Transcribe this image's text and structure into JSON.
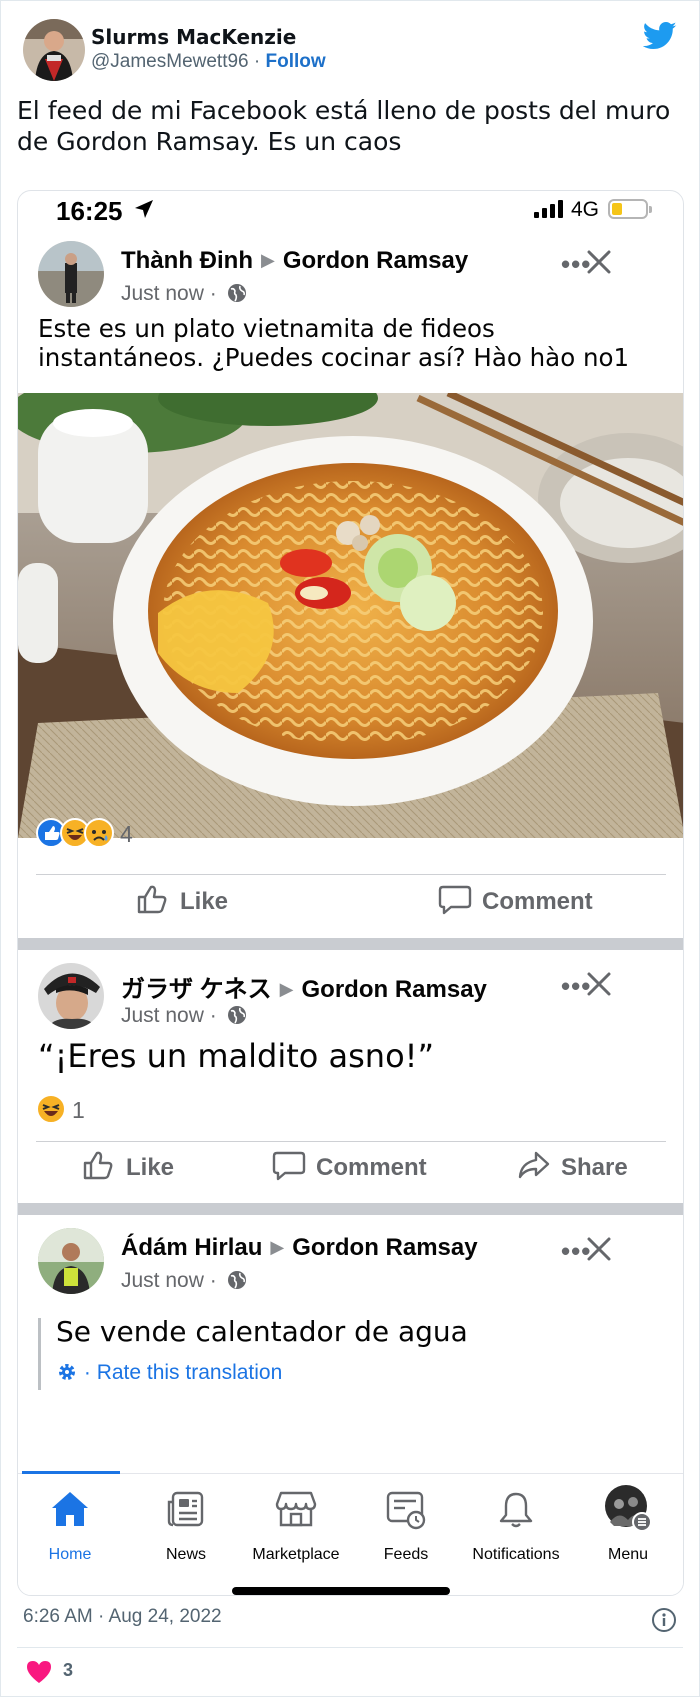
{
  "tweet": {
    "author_name": "Slurms MacKenzie",
    "handle": "@JamesMewett96",
    "separator": "·",
    "follow_label": "Follow",
    "text": "El feed de mi Facebook está lleno de posts del muro de Gordon Ramsay. Es un caos",
    "timestamp": "6:26 AM · Aug 24, 2022",
    "like_count": "3",
    "brand_color": "#1d9bf0",
    "like_color": "#f91880"
  },
  "phone": {
    "time": "16:25",
    "network": "4G"
  },
  "posts": [
    {
      "author": "Thành Đinh",
      "target": "Gordon Ramsay",
      "time": "Just now",
      "dot": "·",
      "text": "Este es un plato vietnamita de fideos instantáneos. ¿Puedes cocinar así? Hào hào no1",
      "reactions": [
        "like",
        "haha",
        "sad"
      ],
      "reaction_count": "4",
      "actions": [
        "Like",
        "Comment"
      ]
    },
    {
      "author": "ガラザ ケネス",
      "target": "Gordon Ramsay",
      "time": "Just now",
      "dot": "·",
      "text": "“¡Eres un maldito asno!”",
      "reactions": [
        "haha"
      ],
      "reaction_count": "1",
      "actions": [
        "Like",
        "Comment",
        "Share"
      ]
    },
    {
      "author": "Ádám Hirlau",
      "target": "Gordon Ramsay",
      "time": "Just now",
      "dot": "·",
      "text": "Se vende calentador de agua",
      "translation_link": "Rate this translation",
      "translation_dot": "·"
    }
  ],
  "tabbar": {
    "tabs": [
      {
        "label": "Home",
        "icon": "home-icon",
        "active": true
      },
      {
        "label": "News",
        "icon": "news-icon"
      },
      {
        "label": "Marketplace",
        "icon": "marketplace-icon"
      },
      {
        "label": "Feeds",
        "icon": "feeds-icon"
      },
      {
        "label": "Notifications",
        "icon": "bell-icon"
      },
      {
        "label": "Menu",
        "icon": "menu-avatar"
      }
    ],
    "active_color": "#1b74e4"
  }
}
